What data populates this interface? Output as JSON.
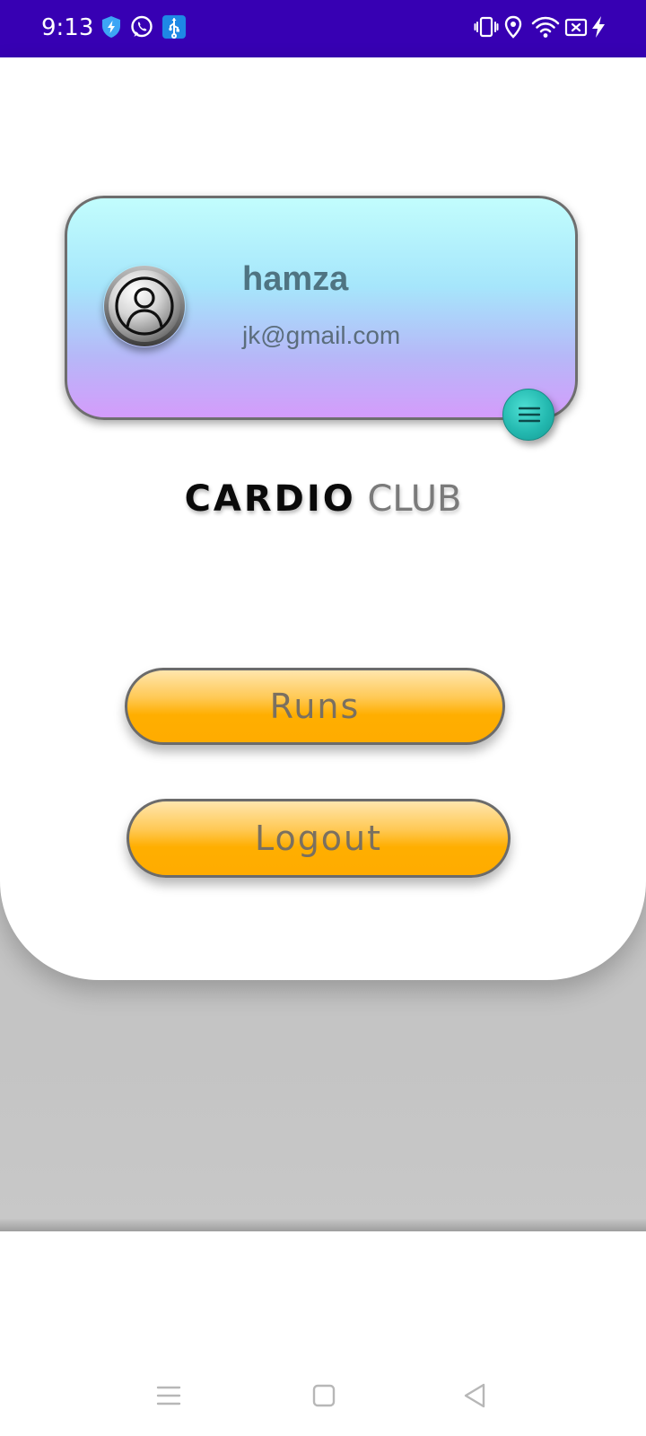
{
  "status_bar": {
    "time": "9:13",
    "background_color": "#3700b3",
    "left_icons": [
      "shield-bolt-icon",
      "whatsapp-icon",
      "usb-icon"
    ],
    "right_icons": [
      "vibrate-icon",
      "location-icon",
      "wifi-icon",
      "no-sim-icon",
      "charging-icon"
    ]
  },
  "profile": {
    "name": "hamza",
    "email": "jk@gmail.com",
    "avatar_icon": "user-avatar-icon",
    "menu_icon": "menu-icon"
  },
  "brand": {
    "bold": "CARDIO",
    "light": "CLUB"
  },
  "buttons": {
    "runs_label": "Runs",
    "logout_label": "Logout"
  },
  "nav_bar": {
    "icons": [
      "recents-icon",
      "home-icon",
      "back-icon"
    ]
  },
  "colors": {
    "button_orange": "#ffae00",
    "fab_teal": "#24b9b0",
    "card_gradient_top": "#c2fdfd",
    "card_gradient_bottom": "#d49cfb"
  }
}
